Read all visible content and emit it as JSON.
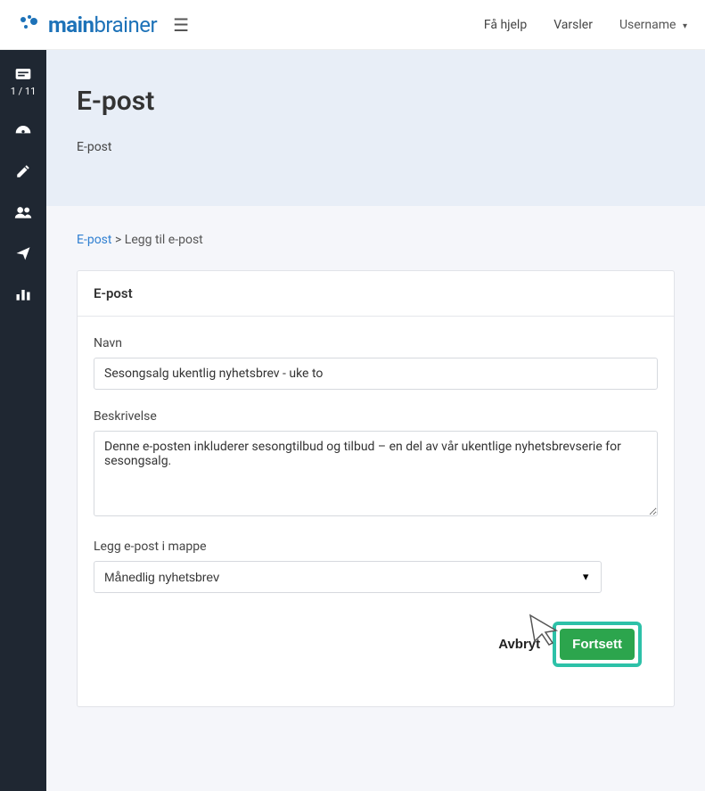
{
  "topbar": {
    "brand_main": "main",
    "brand_sub": "brainer",
    "help_label": "Få hjelp",
    "alerts_label": "Varsler",
    "username_label": "Username"
  },
  "sidebar": {
    "progress": "1 / 11"
  },
  "hero": {
    "title": "E-post",
    "subtitle": "E-post"
  },
  "breadcrumb": {
    "root": "E-post",
    "sep": ">",
    "current": "Legg til e-post"
  },
  "card": {
    "title": "E-post"
  },
  "form": {
    "name_label": "Navn",
    "name_value": "Sesongsalg ukentlig nyhetsbrev - uke to",
    "description_label": "Beskrivelse",
    "description_value": "Denne e-posten inkluderer sesongtilbud og tilbud – en del av vår ukentlige nyhetsbrevserie for sesongsalg.",
    "folder_label": "Legg e-post i mappe",
    "folder_value": "Månedlig nyhetsbrev"
  },
  "actions": {
    "cancel": "Avbryt",
    "continue": "Fortsett"
  }
}
